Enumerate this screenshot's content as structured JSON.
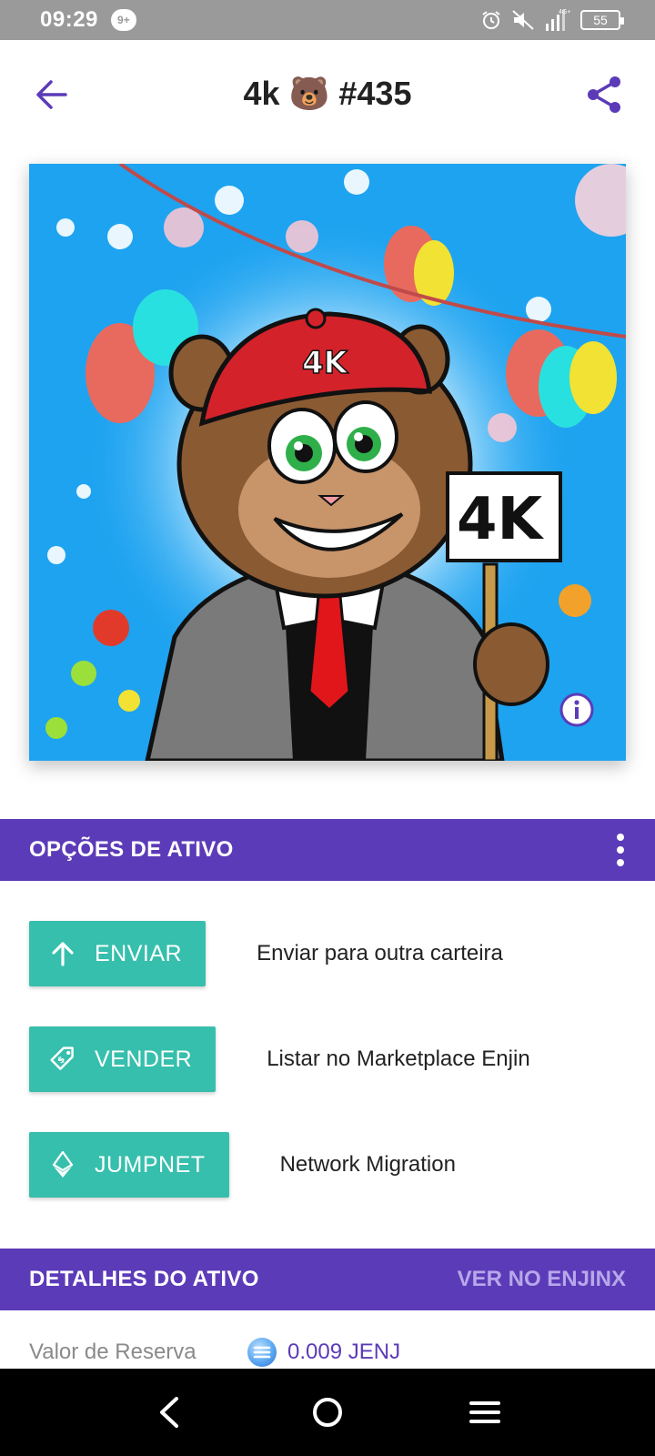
{
  "status_bar": {
    "time": "09:29",
    "notification_count": "9+",
    "network": "4G+",
    "battery": "55"
  },
  "app_bar": {
    "title": "4k 🐻 #435"
  },
  "nft": {
    "sign_text": "4K",
    "cap_text": "4K"
  },
  "asset_options": {
    "title": "OPÇÕES DE ATIVO",
    "actions": [
      {
        "label": "ENVIAR",
        "description": "Enviar para outra carteira",
        "icon": "arrow-up-icon"
      },
      {
        "label": "VENDER",
        "description": "Listar no Marketplace Enjin",
        "icon": "price-tag-icon"
      },
      {
        "label": "JUMPNET",
        "description": "Network Migration",
        "icon": "ethereum-icon"
      }
    ]
  },
  "asset_details": {
    "title": "DETALHES DO ATIVO",
    "link": "VER NO ENJINX",
    "rows": [
      {
        "label": "Valor de Reserva",
        "value": "0.009 JENJ",
        "icon": "enj-coin-icon"
      }
    ]
  },
  "colors": {
    "primary": "#5c3bb8",
    "accent": "#36bfac",
    "status_bar": "#9a9a9a"
  }
}
